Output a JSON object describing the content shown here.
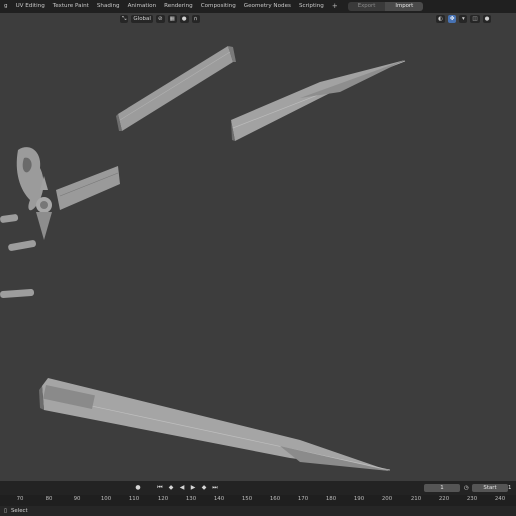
{
  "workspace_tabs": [
    "g",
    "UV Editing",
    "Texture Paint",
    "Shading",
    "Animation",
    "Rendering",
    "Compositing",
    "Geometry Nodes",
    "Scripting"
  ],
  "add_tab_label": "+",
  "io": {
    "export_label": "Export",
    "import_label": "Import"
  },
  "viewport_header": {
    "orientation_label": "Global"
  },
  "timeline": {
    "current_frame": "1",
    "start_label": "Start",
    "start_value": "1"
  },
  "ruler_ticks": [
    "70",
    "80",
    "90",
    "100",
    "110",
    "120",
    "130",
    "140",
    "150",
    "160",
    "170",
    "180",
    "190",
    "200",
    "210",
    "220",
    "230",
    "240"
  ],
  "status": {
    "select_label": "Select"
  },
  "colors": {
    "accent": "#4772b3",
    "background": "#3d3d3d",
    "topbar": "#202020",
    "mesh": "#9a9a9a"
  }
}
